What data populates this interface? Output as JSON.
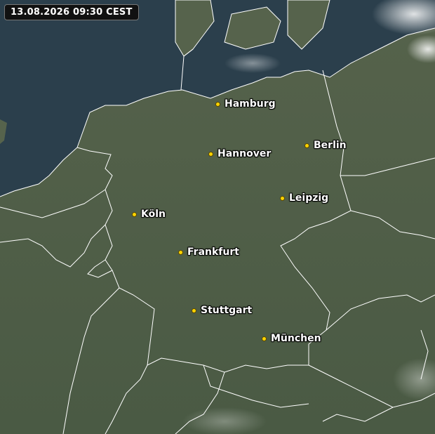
{
  "map": {
    "timestamp": "13.08.2026 09:30 CEST",
    "colors": {
      "sea": "#2b3f4c",
      "land": "#4f5d47",
      "border": "#ffffff",
      "city_dot": "#ffd400"
    },
    "cities": [
      {
        "name": "Hamburg"
      },
      {
        "name": "Berlin"
      },
      {
        "name": "Hannover"
      },
      {
        "name": "Leipzig"
      },
      {
        "name": "Köln"
      },
      {
        "name": "Frankfurt"
      },
      {
        "name": "Stuttgart"
      },
      {
        "name": "München"
      }
    ]
  }
}
